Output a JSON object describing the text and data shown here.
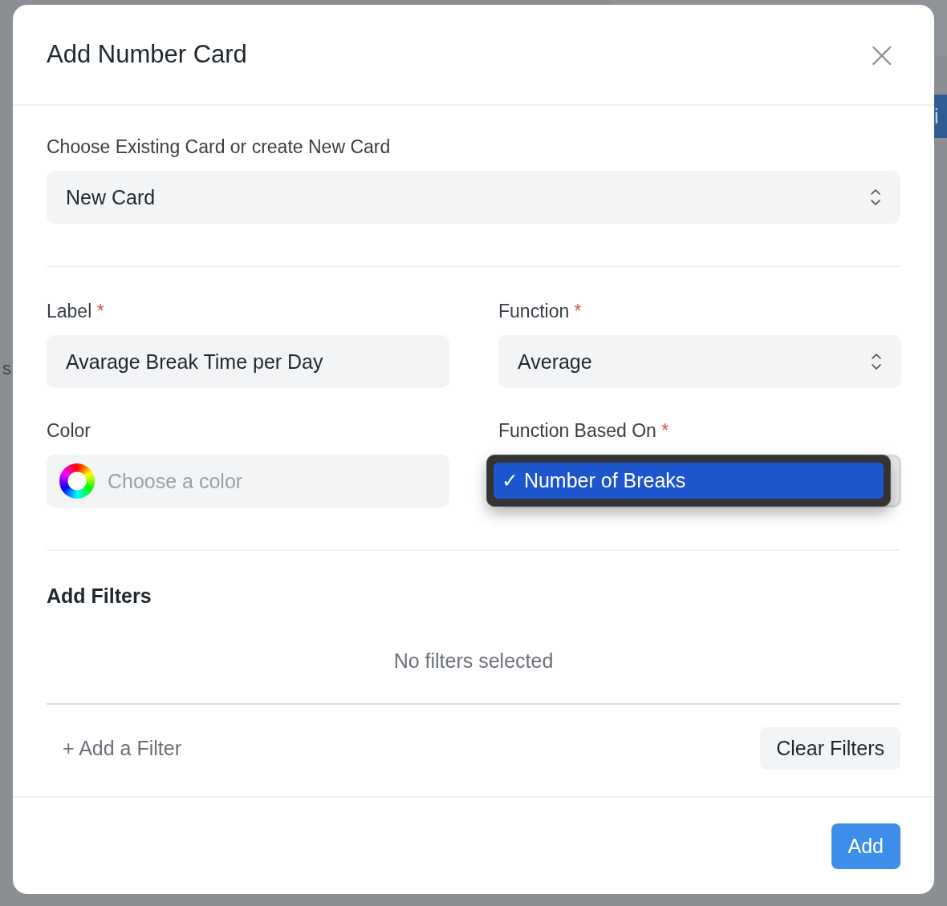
{
  "background": {
    "button_fragment": "i",
    "left_fragments": [
      "s"
    ]
  },
  "dialog": {
    "title": "Add Number Card",
    "close_icon": "×"
  },
  "card_choice": {
    "label": "Choose Existing Card or create New Card",
    "value": "New Card"
  },
  "label_field": {
    "label": "Label",
    "required_mark": "*",
    "value": "Avarage Break Time per Day"
  },
  "function_field": {
    "label": "Function",
    "required_mark": "*",
    "value": "Average"
  },
  "color_field": {
    "label": "Color",
    "placeholder": "Choose a color"
  },
  "based_on_field": {
    "label": "Function Based On",
    "required_mark": "*",
    "options": [
      {
        "check": "✓",
        "text": "Number of Breaks",
        "selected": true
      }
    ]
  },
  "filters": {
    "title": "Add Filters",
    "empty_text": "No filters selected",
    "add_link": "+ Add a Filter",
    "clear_button": "Clear Filters"
  },
  "footer": {
    "primary_button": "Add"
  }
}
